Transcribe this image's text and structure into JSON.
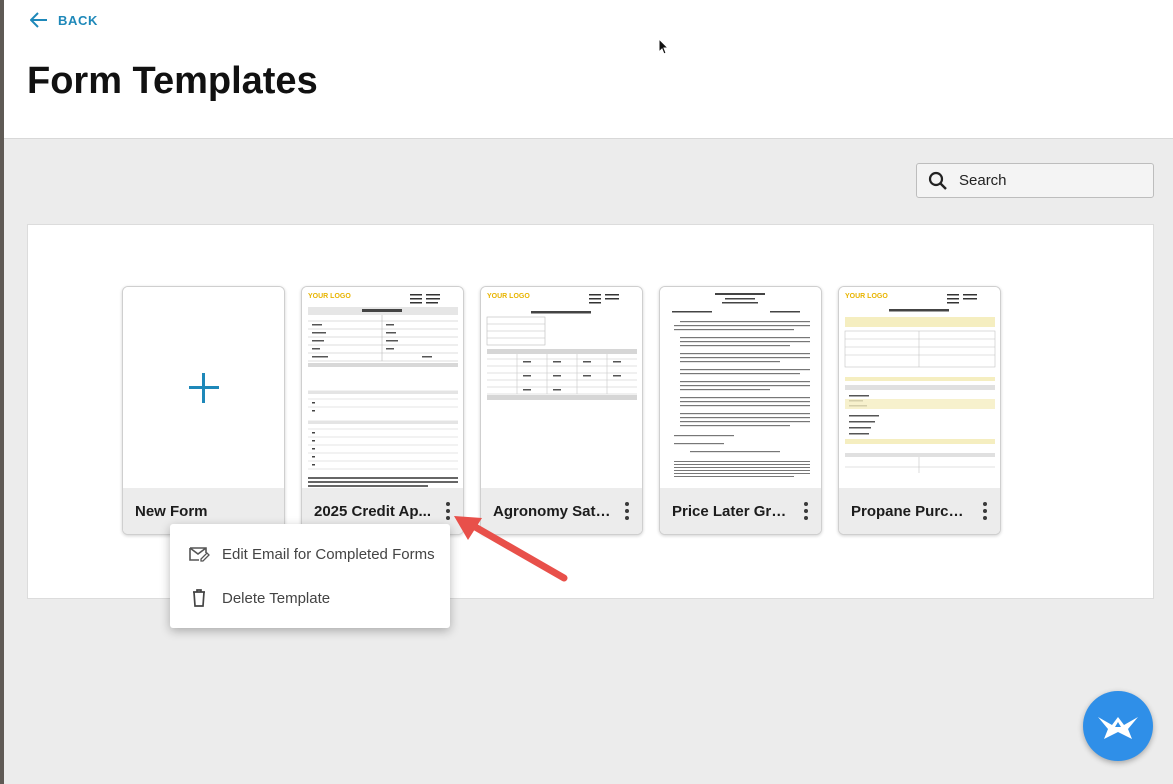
{
  "header": {
    "back_label": "BACK",
    "title": "Form Templates"
  },
  "search": {
    "placeholder": "Search"
  },
  "cards": [
    {
      "name": "New Form"
    },
    {
      "name": "2025 Credit Ap..."
    },
    {
      "name": "Agronomy Sati..."
    },
    {
      "name": "Price Later Gra..."
    },
    {
      "name": "Propane Purch..."
    }
  ],
  "context_menu": {
    "items": [
      {
        "label": "Edit Email for Completed Forms",
        "icon": "mail-edit-icon"
      },
      {
        "label": "Delete Template",
        "icon": "trash-icon"
      }
    ]
  },
  "colors": {
    "accent": "#1e88b9",
    "arrow": "#e8504a",
    "fab": "#2f8fe8"
  },
  "thumbnails": {
    "logo_text": "YOUR LOGO"
  }
}
